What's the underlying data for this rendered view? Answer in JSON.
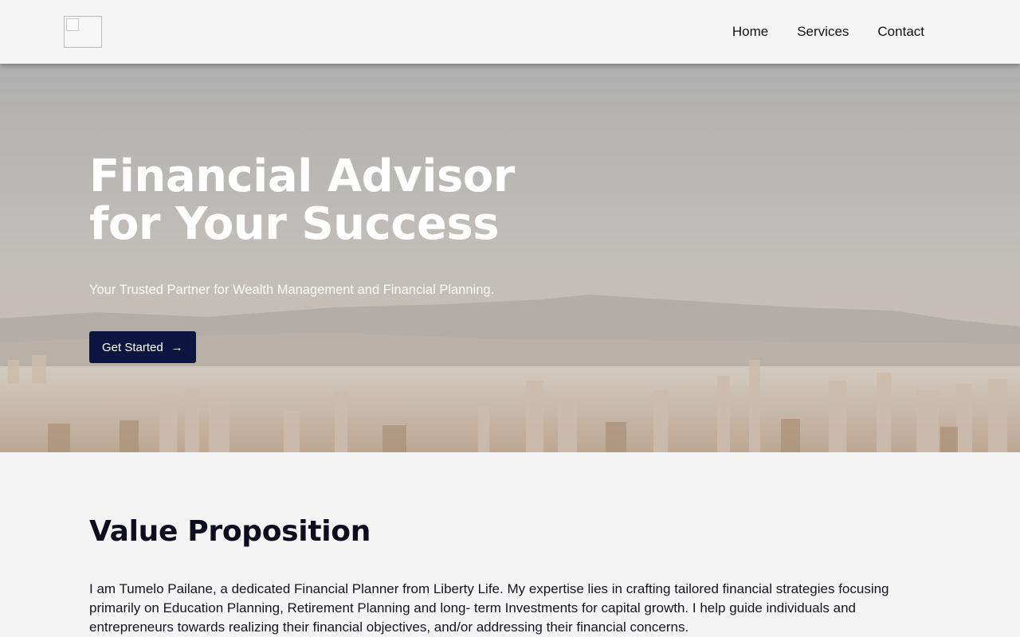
{
  "header": {
    "logo_alt": "",
    "nav": [
      {
        "label": "Home"
      },
      {
        "label": "Services"
      },
      {
        "label": "Contact"
      }
    ]
  },
  "hero": {
    "title_line1": "Financial Advisor",
    "title_line2": "for Your Success",
    "subtitle": "Your Trusted Partner for Wealth Management and Financial Planning.",
    "cta_label": "Get Started",
    "cta_icon": "arrow-right-icon",
    "cta_color": "#0b1540"
  },
  "value": {
    "heading": "Value Proposition",
    "body": "I am Tumelo Pailane, a dedicated Financial Planner from Liberty Life. My expertise lies in crafting tailored financial strategies focusing primarily on Education Planning, Retirement Planning and long- term Investments for capital growth. I help guide individuals and entrepreneurs towards realizing their financial objectives, and/or addressing their financial concerns."
  }
}
